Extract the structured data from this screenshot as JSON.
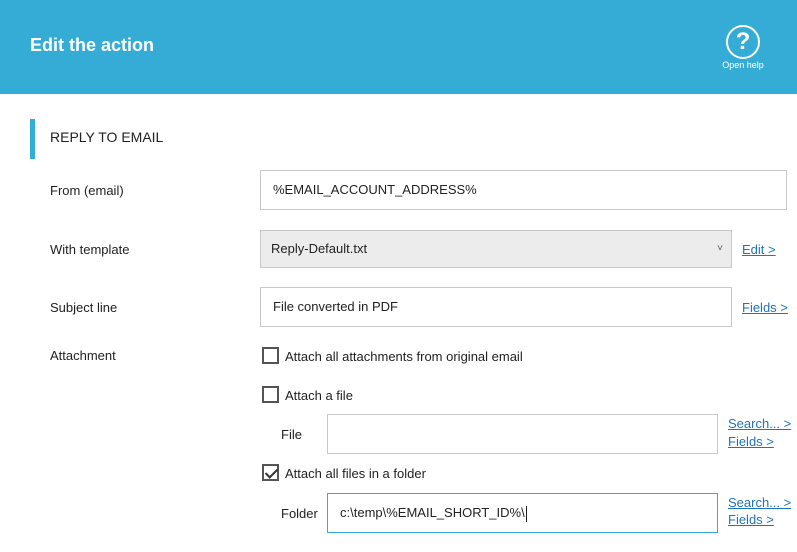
{
  "header": {
    "title": "Edit the action",
    "help_glyph": "?",
    "help_label": "Open help",
    "background_color": "#35acd6"
  },
  "section": {
    "title": "REPLY TO EMAIL"
  },
  "from": {
    "label": "From (email)",
    "value": "%EMAIL_ACCOUNT_ADDRESS%"
  },
  "template": {
    "label": "With template",
    "value": "Reply-Default.txt",
    "chevron": "˅",
    "edit_link": "Edit >"
  },
  "subject": {
    "label": "Subject line",
    "value": "File converted in PDF",
    "fields_link": "Fields >"
  },
  "attachment": {
    "label": "Attachment",
    "attach_all_original": {
      "label": "Attach all attachments from original email",
      "checked": false
    },
    "attach_file": {
      "label": "Attach a file",
      "checked": false
    },
    "file_label": "File",
    "file_value": "",
    "file_search_link": "Search... >",
    "file_fields_link": "Fields >",
    "attach_folder": {
      "label": "Attach all files in a folder",
      "checked": true
    },
    "folder_label": "Folder",
    "folder_value": "c:\\temp\\%EMAIL_SHORT_ID%\\",
    "folder_search_link": "Search... >",
    "folder_fields_link": "Fields >"
  }
}
